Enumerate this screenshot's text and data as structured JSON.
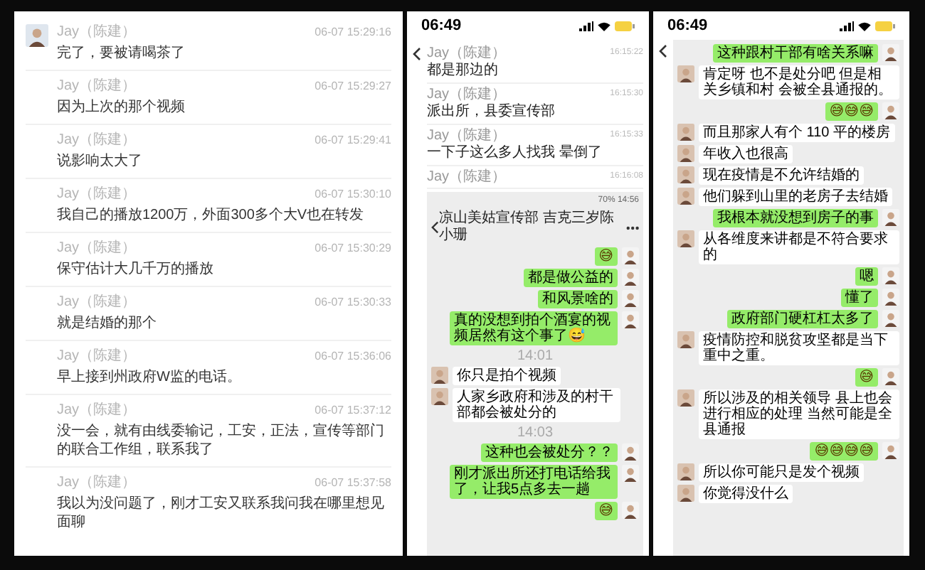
{
  "desktop_chat": {
    "messages": [
      {
        "sender": "Jay（陈建）",
        "time": "06-07 15:29:16",
        "text": "完了，要被请喝茶了",
        "show_avatar": true
      },
      {
        "sender": "Jay（陈建）",
        "time": "06-07 15:29:27",
        "text": "因为上次的那个视频",
        "show_avatar": false
      },
      {
        "sender": "Jay（陈建）",
        "time": "06-07 15:29:41",
        "text": "说影响太大了",
        "show_avatar": false
      },
      {
        "sender": "Jay（陈建）",
        "time": "06-07 15:30:10",
        "text": "我自己的播放1200万，外面300多个大V也在转发",
        "show_avatar": false
      },
      {
        "sender": "Jay（陈建）",
        "time": "06-07 15:30:29",
        "text": "保守估计大几千万的播放",
        "show_avatar": false
      },
      {
        "sender": "Jay（陈建）",
        "time": "06-07 15:30:33",
        "text": "就是结婚的那个",
        "show_avatar": false
      },
      {
        "sender": "Jay（陈建）",
        "time": "06-07 15:36:06",
        "text": "早上接到州政府W监的电话。",
        "show_avatar": false
      },
      {
        "sender": "Jay（陈建）",
        "time": "06-07 15:37:12",
        "text": "没一会，就有由线委输记，工安，正法，宣传等部门的联合工作组，联系我了",
        "show_avatar": false
      },
      {
        "sender": "Jay（陈建）",
        "time": "06-07 15:37:58",
        "text": "我以为没问题了，刚才工安又联系我问我在哪里想见面聊",
        "show_avatar": false
      }
    ]
  },
  "phone_1": {
    "status_time": "06:49",
    "header_messages": [
      {
        "sender": "Jay（陈建）",
        "time": "16:15:22",
        "text": "都是那边的"
      },
      {
        "sender": "Jay（陈建）",
        "time": "16:15:30",
        "text": "派出所，县委宣传部"
      },
      {
        "sender": "Jay（陈建）",
        "time": "16:15:33",
        "text": "一下子这么多人找我 晕倒了"
      },
      {
        "sender": "Jay（陈建）",
        "time": "16:16:08"
      }
    ],
    "embedded_screenshot": {
      "status": "70% 14:56",
      "title": "凉山美姑宣传部 吉克三岁陈小珊",
      "messages": [
        {
          "kind": "emoji",
          "text": "😅"
        },
        {
          "kind": "outgoing",
          "text": "都是做公益的"
        },
        {
          "kind": "outgoing",
          "text": "和风景啥的"
        },
        {
          "kind": "outgoing",
          "text": "真的没想到拍个酒宴的视频居然有这个事了😅"
        },
        {
          "kind": "time",
          "text": "14:01"
        },
        {
          "kind": "incoming",
          "text": "你只是拍个视频"
        },
        {
          "kind": "incoming",
          "text": "人家乡政府和涉及的村干部都会被处分的"
        },
        {
          "kind": "time",
          "text": "14:03"
        },
        {
          "kind": "outgoing",
          "text": "这种也会被处分？？"
        },
        {
          "kind": "outgoing",
          "text": "刚才派出所还打电话给我了，让我5点多去一趟"
        },
        {
          "kind": "emoji",
          "text": "😅"
        }
      ]
    }
  },
  "phone_2": {
    "status_time": "06:49",
    "messages": [
      {
        "kind": "outgoing",
        "text": "这种跟村干部有啥关系嘛"
      },
      {
        "kind": "incoming",
        "text": "肯定呀 也不是处分吧 但是相关乡镇和村 会被全县通报的。"
      },
      {
        "kind": "emoji",
        "text": "😅😅😅"
      },
      {
        "kind": "incoming",
        "text": "而且那家人有个 110 平的楼房"
      },
      {
        "kind": "incoming",
        "text": "年收入也很高"
      },
      {
        "kind": "incoming",
        "text": "现在疫情是不允许结婚的"
      },
      {
        "kind": "incoming",
        "text": "他们躲到山里的老房子去结婚"
      },
      {
        "kind": "outgoing",
        "text": "我根本就没想到房子的事"
      },
      {
        "kind": "incoming",
        "text": "从各维度来讲都是不符合要求的"
      },
      {
        "kind": "outgoing",
        "text": "嗯"
      },
      {
        "kind": "outgoing",
        "text": "懂了"
      },
      {
        "kind": "outgoing",
        "text": "政府部门硬杠杠太多了"
      },
      {
        "kind": "incoming",
        "text": "疫情防控和脱贫攻坚都是当下重中之重。"
      },
      {
        "kind": "emoji",
        "text": "😅"
      },
      {
        "kind": "incoming",
        "text": "所以涉及的相关领导 县上也会进行相应的处理 当然可能是全县通报"
      },
      {
        "kind": "emoji",
        "text": "😅😅😅😅"
      },
      {
        "kind": "incoming",
        "text": "所以你可能只是发个视频"
      },
      {
        "kind": "incoming",
        "text": "你觉得没什么"
      }
    ]
  }
}
